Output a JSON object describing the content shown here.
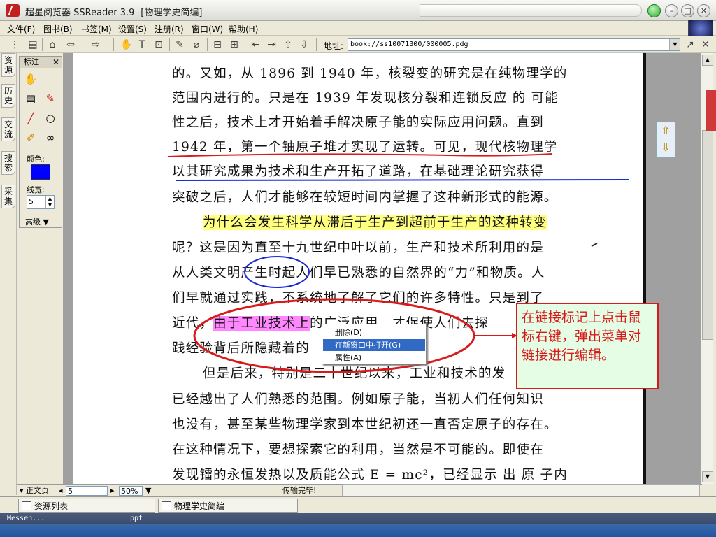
{
  "window": {
    "title": "超星阅览器 SSReader 3.9 -[物理学史简编]"
  },
  "menu": [
    "文件(F)",
    "图书(B)",
    "书签(M)",
    "设置(S)",
    "注册(R)",
    "窗口(W)",
    "帮助(H)"
  ],
  "address": {
    "label": "地址:",
    "value": "book://ss10071300/000005.pdg"
  },
  "left_tabs": [
    "资源",
    "历史",
    "交流",
    "搜索",
    "采集"
  ],
  "annotation_panel": {
    "title": "标注",
    "color_label": "颜色:",
    "width_label": "线宽:",
    "width_value": "5",
    "advanced": "高级",
    "color": "#0000ff"
  },
  "document": {
    "lines": [
      "的。又如，从 1896 到 1940 年，核裂变的研究是在纯物理学的",
      "范围内进行的。只是在 1939 年发现核分裂和连锁反应 的 可能",
      "性之后，技术上才开始着手解决原子能的实际应用问题。直到",
      "1942 年，第一个铀原子堆才实现了运转。可见，现代核物理学",
      "以其研究成果为技术和生产开拓了道路，在基础理论研究获得",
      "突破之后，人们才能够在较短时间内掌握了这种新形式的能源。"
    ],
    "highlight_yellow": "为什么会发生科学从滞后于生产到超前于生产的这种转变",
    "line_7": "呢？这是因为直至十九世纪中叶以前，生产和技术所利用的是",
    "line_8": "从人类文明产生时起人们早已熟悉的自然界的“力”和物质。人",
    "line_9": "们早就通过实践，不系统地了解了它们的许多特性。只是到了",
    "line_10_start": "近代，",
    "highlight_pink": "由于工业技术上",
    "line_10_end": "的广泛应用，才促使人们去探",
    "line_11": "践经验背后所隐藏着的",
    "lines_after": [
      "但是后来，特别是二十世纪以来，工业和技术的发",
      "已经越出了人们熟悉的范围。例如原子能，当初人们任何知识",
      "也没有，甚至某些物理学家到本世纪初还一直否定原子的存在。",
      "在这种情况下，要想探索它的利用，当然是不可能的。即使在",
      "发现镭的永恒发热以及质能公式 E = mc²，已经显示 出 原 子内"
    ]
  },
  "context_menu": {
    "items": [
      "删除(D)",
      "在新窗口中打开(G)",
      "属性(A)"
    ],
    "active_index": 1
  },
  "callout": {
    "text": "在链接标记上点击鼠标右键，弹出菜单对链接进行编辑。"
  },
  "status": {
    "view_mode": "正文页",
    "page": "5",
    "zoom": "50%",
    "transfer": "传输完毕!"
  },
  "bottom_tabs": [
    "资源列表",
    "物理学史简编"
  ],
  "taskbar": {
    "left": "Messen...",
    "right": "ppt"
  },
  "colors": {
    "annotation_red": "#d81a1a",
    "annotation_blue": "#1a2ad8",
    "highlight_yellow": "#ffff80",
    "highlight_pink": "#ff88ff"
  }
}
